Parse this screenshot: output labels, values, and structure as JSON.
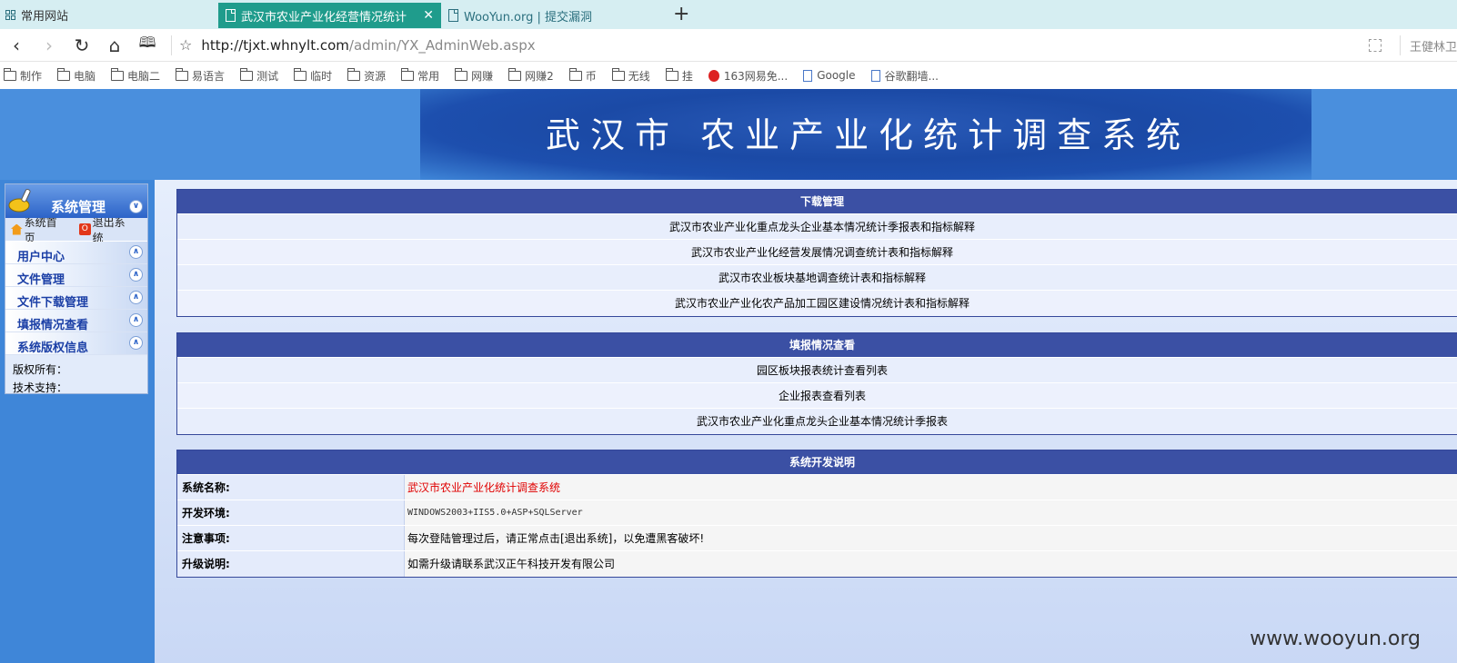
{
  "browser": {
    "fav_label": "常用网站",
    "tabs": [
      {
        "label": "武汉市农业产业化经营情况统计",
        "active": true
      },
      {
        "label": "WooYun.org | 提交漏洞",
        "active": false
      }
    ],
    "new_tab": "+",
    "close": "✕",
    "url_host": "http://tjxt.whnylt.com",
    "url_path": "/admin/YX_AdminWeb.aspx",
    "user": "王健林卫",
    "bookmarks": [
      "制作",
      "电脑",
      "电脑二",
      "易语言",
      "测试",
      "临时",
      "资源",
      "常用",
      "网赚",
      "网赚2",
      "币",
      "无线",
      "挂",
      "163网易免...",
      "Google",
      "谷歌翻墙..."
    ]
  },
  "banner": {
    "title": "武汉市 农业产业化统计调查系统"
  },
  "sidebar": {
    "title": "系统管理",
    "home_link": "系统首页",
    "exit_link": "退出系统",
    "items": [
      "用户中心",
      "文件管理",
      "文件下载管理",
      "填报情况查看",
      "系统版权信息"
    ],
    "footer": [
      "版权所有：",
      "技术支持："
    ]
  },
  "panels": {
    "download": {
      "title": "下载管理",
      "rows": [
        "武汉市农业产业化重点龙头企业基本情况统计季报表和指标解释",
        "武汉市农业产业化经营发展情况调查统计表和指标解释",
        "武汉市农业板块基地调查统计表和指标解释",
        "武汉市农业产业化农产品加工园区建设情况统计表和指标解释"
      ]
    },
    "report": {
      "title": "填报情况查看",
      "rows": [
        "园区板块报表统计查看列表",
        "企业报表查看列表",
        "武汉市农业产业化重点龙头企业基本情况统计季报表"
      ]
    },
    "devinfo": {
      "title": "系统开发说明",
      "rows": [
        {
          "label": "系统名称:",
          "value": "武汉市农业产业化统计调查系统"
        },
        {
          "label": "开发环境:",
          "value": "WINDOWS2003+IIS5.0+ASP+SQLServer"
        },
        {
          "label": "注意事项:",
          "value": "每次登陆管理过后，请正常点击[退出系统]，以免遭黑客破坏!"
        },
        {
          "label": "升级说明:",
          "value": "如需升级请联系武汉正午科技开发有限公司"
        }
      ]
    }
  },
  "watermark": "www.wooyun.org",
  "colors": {
    "page_blue": "#3f86d8",
    "panel_header": "#3b50a4",
    "tab_active": "#1f9c8c",
    "highlight_red": "#e00000"
  }
}
